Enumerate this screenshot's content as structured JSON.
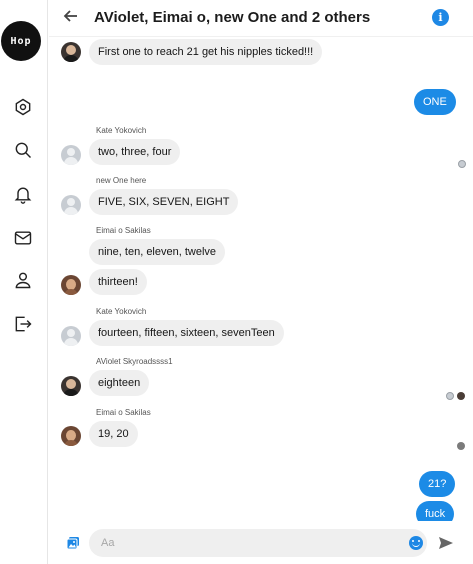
{
  "sidebar": {
    "logo_text": "Hop",
    "items": [
      {
        "icon": "home-icon"
      },
      {
        "icon": "search-icon"
      },
      {
        "icon": "bell-icon"
      },
      {
        "icon": "mail-icon"
      },
      {
        "icon": "profile-icon"
      },
      {
        "icon": "logout-icon"
      }
    ]
  },
  "header": {
    "title": "AViolet, Eimai o, new One and 2 others",
    "info_glyph": "i"
  },
  "messages": [
    {
      "id": "m1",
      "direction": "in",
      "sender": "",
      "text": "First one to reach 21 get his nipples ticked!!!"
    },
    {
      "id": "m2",
      "direction": "out",
      "sender": "",
      "text": "ONE"
    },
    {
      "id": "m3",
      "direction": "in",
      "sender": "Kate Yokovich",
      "text": "two, three, four"
    },
    {
      "id": "m4",
      "direction": "in",
      "sender": "new One here",
      "text": "FIVE, SIX, SEVEN, EIGHT"
    },
    {
      "id": "m5",
      "direction": "in",
      "sender": "Eimai o Sakilas",
      "text": "nine, ten, eleven, twelve"
    },
    {
      "id": "m6",
      "direction": "in",
      "sender": "",
      "text": "thirteen!"
    },
    {
      "id": "m7",
      "direction": "in",
      "sender": "Kate Yokovich",
      "text": "fourteen, fifteen, sixteen, sevenTeen"
    },
    {
      "id": "m8",
      "direction": "in",
      "sender": "AViolet Skyroadssss1",
      "text": "eighteen"
    },
    {
      "id": "m9",
      "direction": "in",
      "sender": "Eimai o Sakilas",
      "text": "19, 20"
    },
    {
      "id": "m10",
      "direction": "out",
      "sender": "",
      "text": "21?"
    },
    {
      "id": "m11",
      "direction": "out",
      "sender": "",
      "text": "fuck"
    }
  ],
  "composer": {
    "placeholder": "Aa",
    "value": ""
  },
  "colors": {
    "accent": "#1c8be6",
    "incoming_bubble": "#efefef"
  }
}
